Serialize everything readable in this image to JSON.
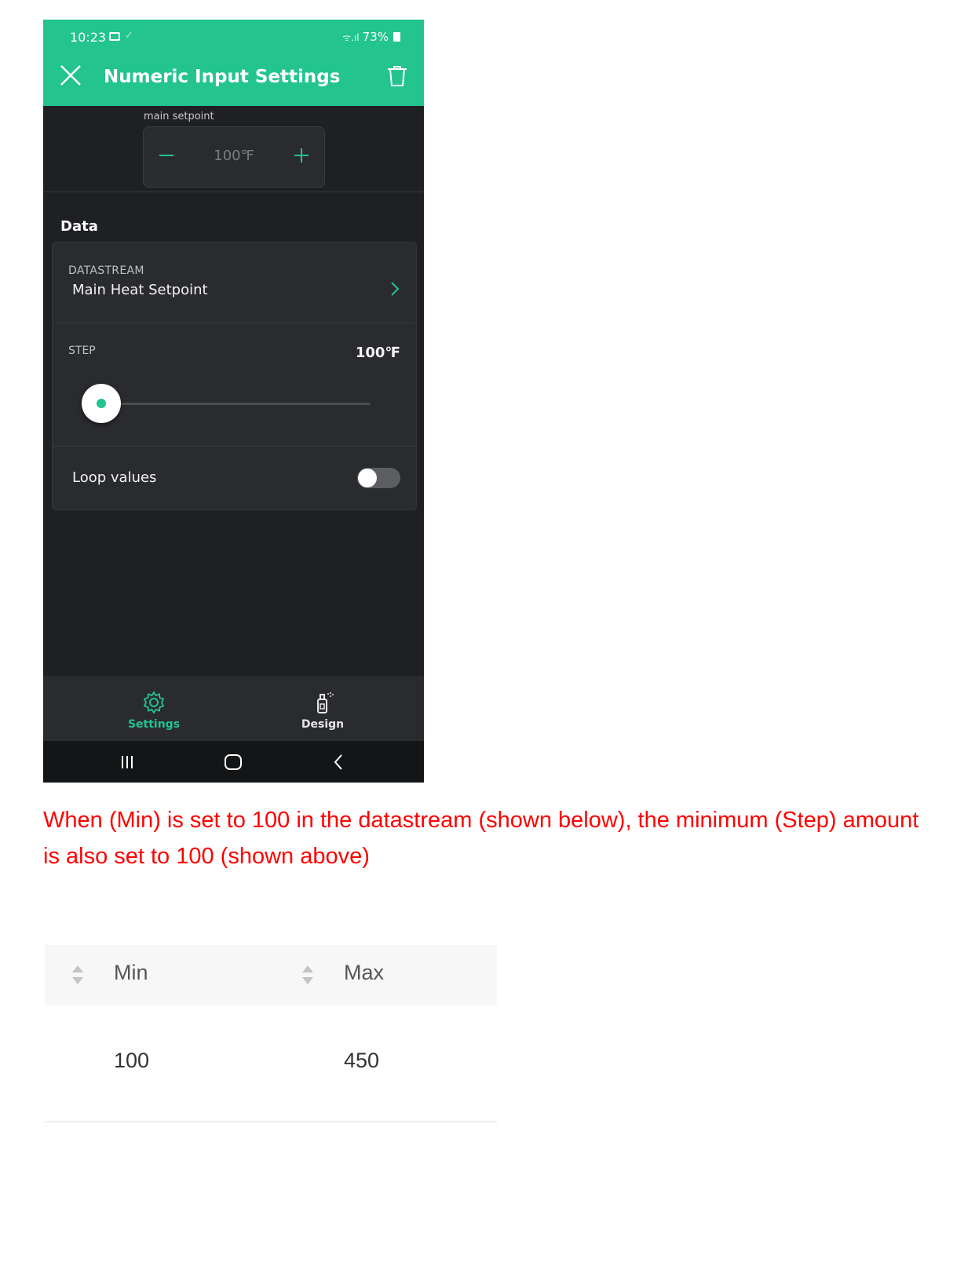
{
  "status_bar": {
    "time": "10:23",
    "battery": "73%"
  },
  "app_bar": {
    "title": "Numeric Input Settings"
  },
  "preview": {
    "label": "main setpoint",
    "value": "100℉"
  },
  "data_section": {
    "title": "Data",
    "datastream_label": "DATASTREAM",
    "datastream_value": "Main Heat Setpoint",
    "step_label": "STEP",
    "step_value": "100℉",
    "step_slider_fraction": 0.0,
    "loop_label": "Loop values",
    "loop_enabled": false
  },
  "tabs": [
    {
      "label": "Settings",
      "active": true
    },
    {
      "label": "Design",
      "active": false
    }
  ],
  "note": "When (Min) is set to 100 in the datastream (shown below), the minimum (Step) amount is also set to 100 (shown above)",
  "table": {
    "headers": [
      "Min",
      "Max"
    ],
    "rows": [
      [
        "100",
        "450"
      ]
    ]
  },
  "colors": {
    "accent": "#23c48e",
    "background_dark": "#1f2023",
    "card": "#2a2b2f",
    "note_text": "#ff0000"
  }
}
